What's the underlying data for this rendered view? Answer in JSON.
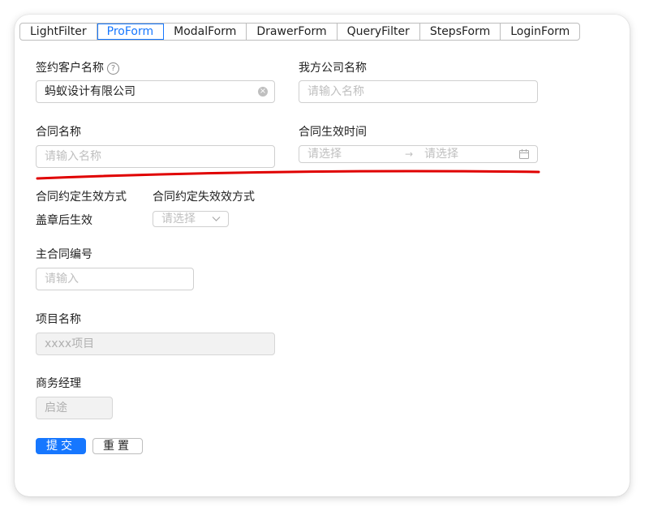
{
  "tabs": [
    {
      "label": "LightFilter",
      "active": false
    },
    {
      "label": "ProForm",
      "active": true
    },
    {
      "label": "ModalForm",
      "active": false
    },
    {
      "label": "DrawerForm",
      "active": false
    },
    {
      "label": "QueryFilter",
      "active": false
    },
    {
      "label": "StepsForm",
      "active": false
    },
    {
      "label": "LoginForm",
      "active": false
    }
  ],
  "form": {
    "customer_name": {
      "label": "签约客户名称",
      "help_icon": "?",
      "value": "蚂蚁设计有限公司"
    },
    "company_name": {
      "label": "我方公司名称",
      "placeholder": "请输入名称"
    },
    "contract_name": {
      "label": "合同名称",
      "placeholder": "请输入名称"
    },
    "effective_time": {
      "label": "合同生效时间",
      "start_placeholder": "请选择",
      "separator": "→",
      "end_placeholder": "请选择"
    },
    "effective_method": {
      "label": "合同约定生效方式",
      "value": "盖章后生效"
    },
    "expire_method": {
      "label": "合同约定失效效方式",
      "placeholder": "请选择"
    },
    "main_contract_no": {
      "label": "主合同编号",
      "placeholder": "请输入"
    },
    "project_name": {
      "label": "项目名称",
      "placeholder": "xxxx项目"
    },
    "business_manager": {
      "label": "商务经理",
      "placeholder": "启途"
    }
  },
  "buttons": {
    "submit": "提交",
    "reset": "重置"
  },
  "colors": {
    "primary": "#1677ff",
    "annotation_line": "#e00000"
  },
  "icons": {
    "clear": "clear-icon",
    "help": "question-circle-icon",
    "calendar": "calendar-icon",
    "chevron": "chevron-down-icon"
  }
}
